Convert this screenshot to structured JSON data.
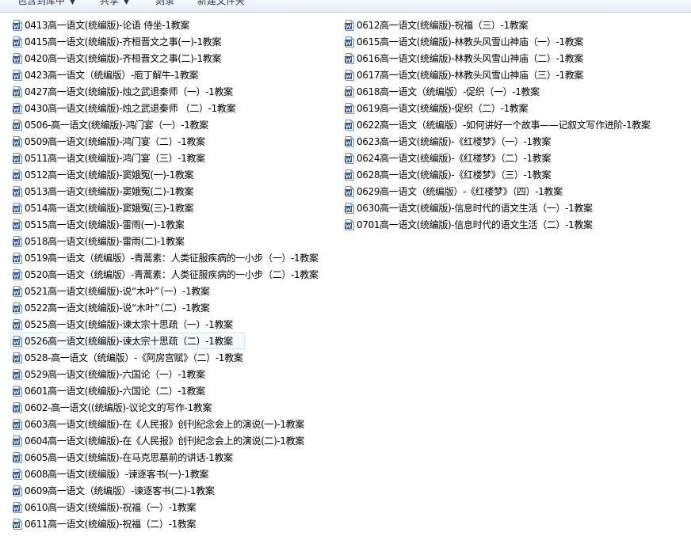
{
  "toolbar": {
    "include_in_library": "包含到库中",
    "share": "共享",
    "burn": "刻录",
    "new_folder": "新建文件夹"
  },
  "colors": {
    "word_icon": "#2b5797",
    "selection_border": "#d3e4f7",
    "selection_bg": "#f5f9fe"
  },
  "files_left": [
    "0413高一语文(统编版)-论语 侍坐-1教案",
    "0415高一语文(统编版)-齐桓晋文之事(一)-1教案",
    "0420高一语文(统编版)-齐桓晋文之事(二)-1教案",
    "0423高一语文（统编版）-庖丁解牛-1教案",
    "0427高一语文(统编版)-烛之武退秦师（一）-1教案",
    "0430高一语文(统编版)-烛之武退秦师 （二）-1教案",
    "0506-高一语文(统编版)-鸿门宴（一）-1教案",
    "0509高一语文(统编版)-鸿门宴（二）-1教案",
    "0511高一语文(统编版)-鸿门宴（三）-1教案",
    "0512高一语文(统编版)-窦娥冤(一)-1教案",
    "0513高一语文(统编版)-窦娥冤(二)-1教案",
    "0514高一语文(统编版)-窦娥冤(三)-1教案",
    "0515高一语文(统编版)-雷雨(一)-1教案",
    "0518高一语文(统编版)-雷雨(二)-1教案",
    "0519高一语文（统编版）-青蒿素：人类征服疾病的一小步（一）-1教案",
    "0520高一语文（统编版）-青蒿素：人类征服疾病的一小步（二）-1教案",
    "0521高一语文(统编版)-说“木叶”（一）-1教案",
    "0522高一语文(统编版)-说“木叶”（二）-1教案",
    "0525高一语文(统编版)-谏太宗十思疏（一）-1教案",
    "0526高一语文(统编版)-谏太宗十思疏（二）-1教案",
    "0528-高一语文（统编版）-《阿房宫赋》（二）-1教案",
    "0529高一语文(统编版)-六国论（一）-1教案",
    "0601高一语文(统编版)-六国论（二）-1教案",
    "0602-高一语文((统编版)-议论文的写作-1教案",
    "0603高一语文(统编版)-在《人民报》创刊纪念会上的演说(一)-1教案",
    "0604高一语文(统编版)-在《人民报》创刊纪念会上的演说(二)-1教案",
    "0605高一语文(统编版)-在马克思墓前的讲话-1教案",
    "0608高一语文(统编版）-谏逐客书(一)-1教案",
    "0609高一语文（统编版）-谏逐客书(二)-1教案",
    "0610高一语文(统编版)-祝福（一）-1教案",
    "0611高一语文(统编版)-祝福（二）-1教案"
  ],
  "selected_left_index": 19,
  "files_right": [
    "0612高一语文(统编版)-祝福（三）-1教案",
    "0615高一语文(统编版)-林教头风雪山神庙（一）-1教案",
    "0616高一语文(统编版)-林教头风雪山神庙（二）-1教案",
    "0617高一语文(统编版)-林教头风雪山神庙（三）-1教案",
    "0618高一语文（统编版）-促织（一）-1教案",
    "0619高一语文(统编版)-促织（二）-1教案",
    "0622高一语文（统编版）-如何讲好一个故事——记叙文写作进阶-1教案",
    "0623高一语文(统编版)-《红楼梦》（一）-1教案",
    "0624高一语文(统编版)-《红楼梦》（二）-1教案",
    "0628高一语文(统编版)-《红楼梦》（三）-1教案",
    "0629高一语文（统编版）-《红楼梦》（四）-1教案",
    "0630高一语文(统编版)-信息时代的语文生活（一）-1教案",
    "0701高一语文(统编版)-信息时代的语文生活（二）-1教案"
  ]
}
